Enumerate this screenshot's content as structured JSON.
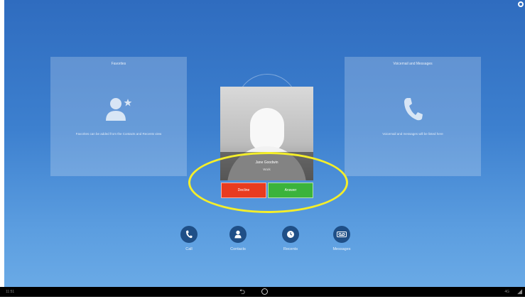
{
  "left_card": {
    "title": "Favorites",
    "text": "Favorites can be added from the Contacts and Recents view"
  },
  "right_card": {
    "title": "Voicemail and Messages",
    "text": "Voicemail and messages will be listed here"
  },
  "incoming_call": {
    "caller_name": "Jane Goodwin",
    "status": "Work",
    "decline_label": "Decline",
    "answer_label": "Answer"
  },
  "dock": {
    "call_label": "Call",
    "contacts_label": "Contacts",
    "recents_label": "Recents",
    "messages_label": "Messages"
  },
  "nav": {
    "time": "11:51",
    "status": "4G"
  },
  "colors": {
    "decline": "#e83b1f",
    "answer": "#3bb33b",
    "highlight": "#f4ee2a",
    "dock_icon": "#1f4f87"
  },
  "icons": {
    "favorites": "person-star-icon",
    "voicemail": "phone-handset-icon",
    "call": "phone-icon",
    "contacts": "person-icon",
    "recents": "clock-icon",
    "messages": "voicemail-icon"
  }
}
